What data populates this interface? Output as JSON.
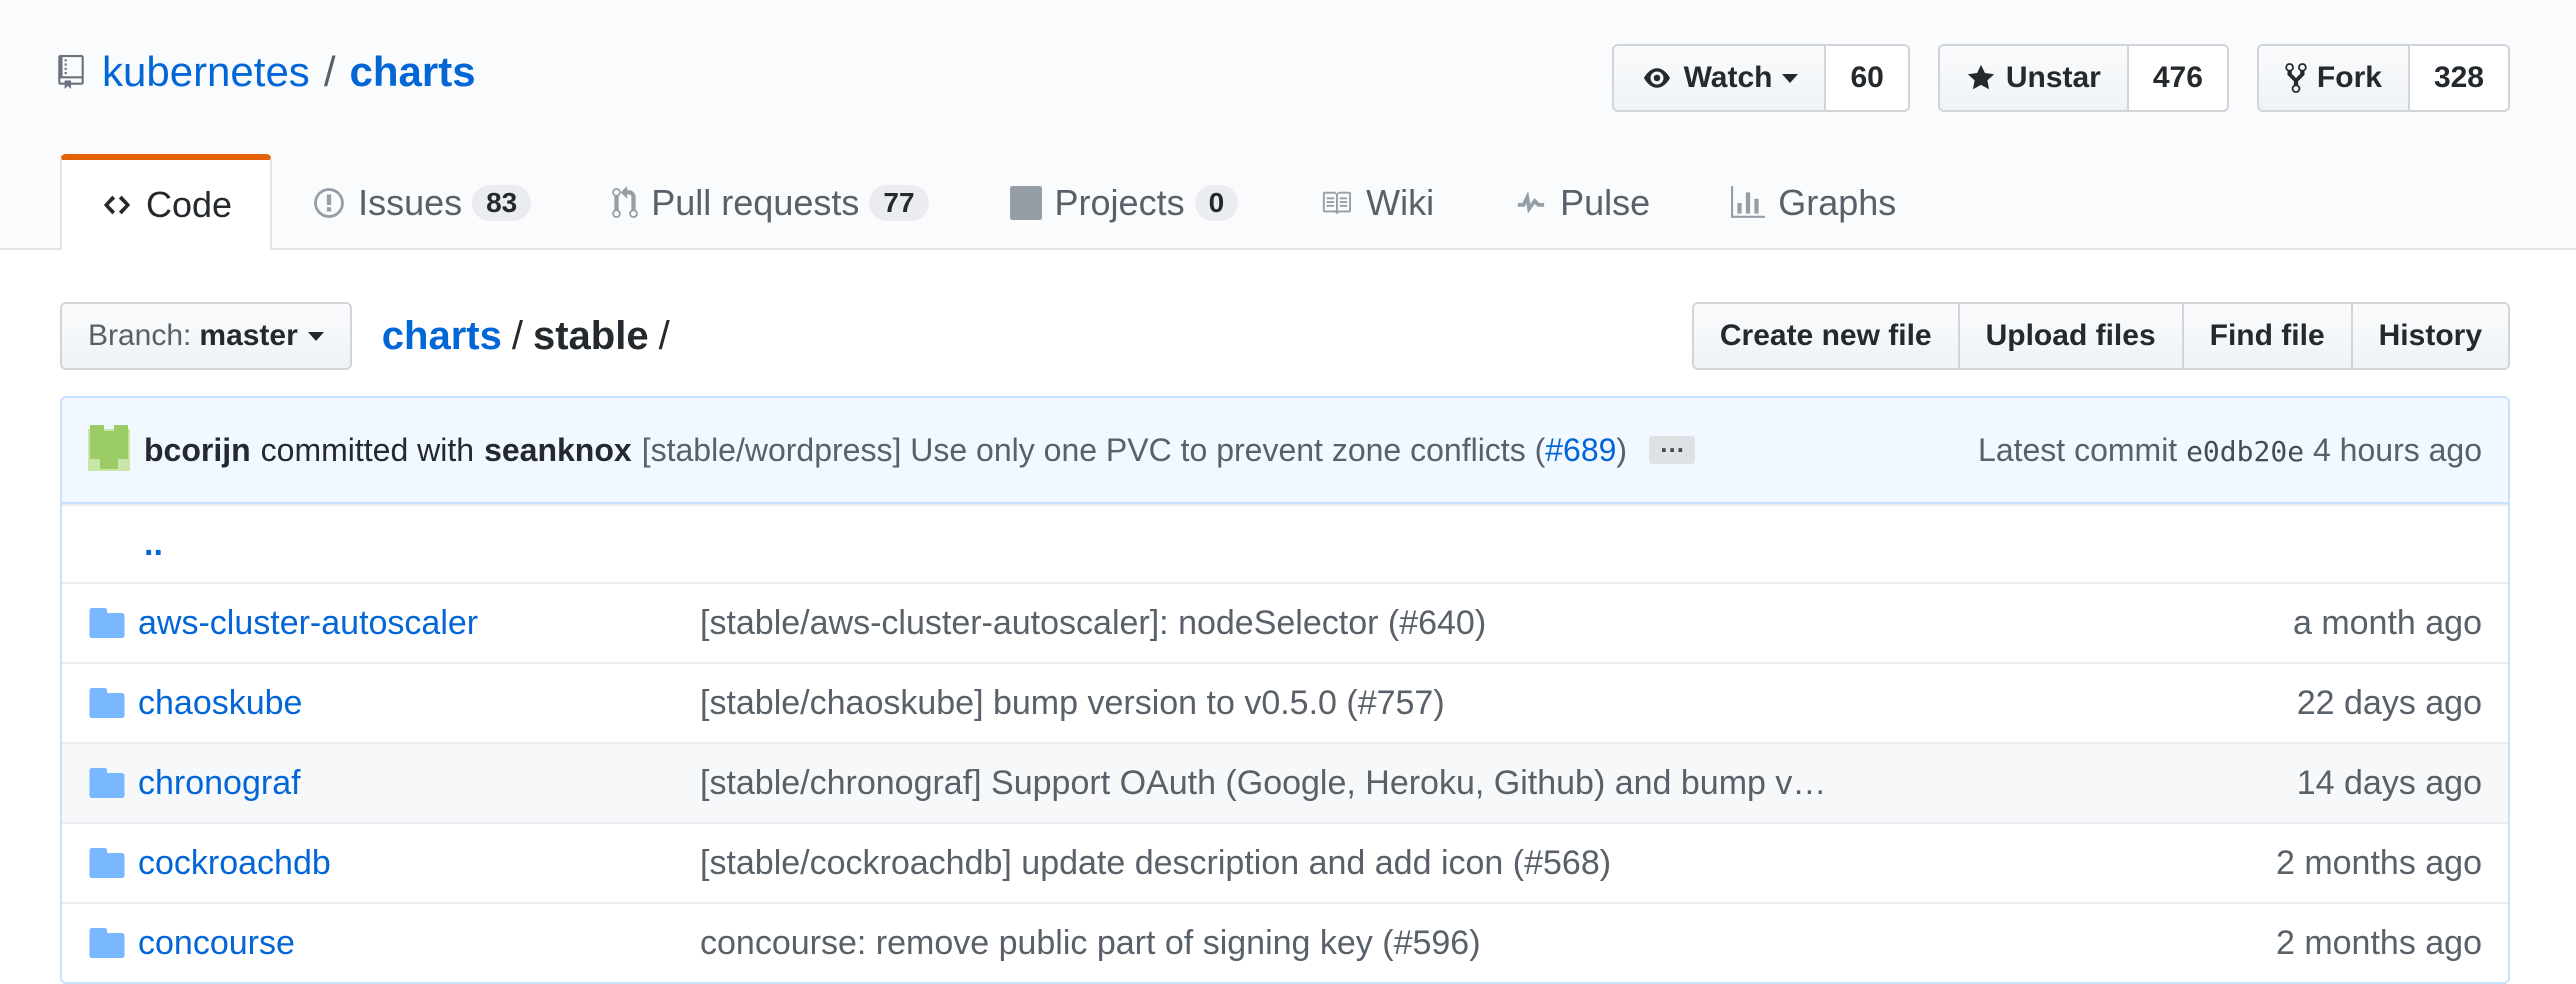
{
  "repo": {
    "owner": "kubernetes",
    "separator": "/",
    "name": "charts"
  },
  "actions": [
    {
      "label": "Watch",
      "count": "60",
      "icon": "eye-icon",
      "has_dropdown": true
    },
    {
      "label": "Unstar",
      "count": "476",
      "icon": "star-icon",
      "has_dropdown": false
    },
    {
      "label": "Fork",
      "count": "328",
      "icon": "fork-icon",
      "has_dropdown": false
    }
  ],
  "tabs": [
    {
      "label": "Code",
      "icon": "code-icon",
      "selected": true
    },
    {
      "label": "Issues",
      "count": "83",
      "icon": "issue-icon"
    },
    {
      "label": "Pull requests",
      "count": "77",
      "icon": "pull-request-icon"
    },
    {
      "label": "Projects",
      "count": "0",
      "icon": "project-icon"
    },
    {
      "label": "Wiki",
      "icon": "book-icon"
    },
    {
      "label": "Pulse",
      "icon": "pulse-icon"
    },
    {
      "label": "Graphs",
      "icon": "graph-icon"
    }
  ],
  "branch": {
    "prefix": "Branch:",
    "name": "master"
  },
  "breadcrumb": {
    "root": "charts",
    "sep": "/",
    "current": "stable",
    "trail": "/"
  },
  "file_actions": [
    "Create new file",
    "Upload files",
    "Find file",
    "History"
  ],
  "commit": {
    "author": "bcorijn",
    "committed_with": "committed with",
    "coauthor": "seanknox",
    "message": "[stable/wordpress] Use only one PVC to prevent zone conflicts (",
    "pr": "#689",
    "message_end": ")",
    "ellipsis": "…",
    "latest_label": "Latest commit",
    "sha": "e0db20e",
    "age": "4 hours ago"
  },
  "up_dir": "..",
  "files": [
    {
      "name": "aws-cluster-autoscaler",
      "message": "[stable/aws-cluster-autoscaler]: nodeSelector (#640)",
      "age": "a month ago"
    },
    {
      "name": "chaoskube",
      "message": "[stable/chaoskube] bump version to v0.5.0 (#757)",
      "age": "22 days ago"
    },
    {
      "name": "chronograf",
      "message": "[stable/chronograf] Support OAuth (Google, Heroku, Github) and bump v…",
      "age": "14 days ago"
    },
    {
      "name": "cockroachdb",
      "message": "[stable/cockroachdb] update description and add icon (#568)",
      "age": "2 months ago"
    },
    {
      "name": "concourse",
      "message": "concourse: remove public part of signing key (#596)",
      "age": "2 months ago"
    }
  ],
  "colors": {
    "link": "#0366d6",
    "tab_accent": "#e36209",
    "folder": "#79b8ff"
  }
}
